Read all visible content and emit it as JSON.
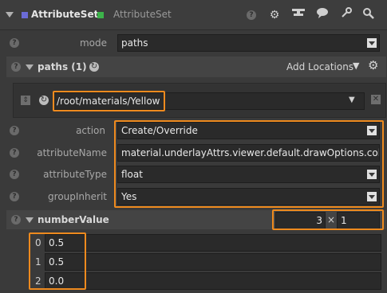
{
  "node": {
    "title": "AttributeSet",
    "subtitle": "AttributeSet",
    "icons": [
      "help-icon",
      "gear-icon",
      "network-icon",
      "chat-icon",
      "wrench-icon",
      "search-icon"
    ]
  },
  "mode": {
    "label": "mode",
    "value": "paths"
  },
  "paths": {
    "title": "paths (1)",
    "add_label": "Add Locations",
    "location": "/root/materials/Yellow"
  },
  "action": {
    "label": "action",
    "value": "Create/Override"
  },
  "attributeName": {
    "label": "attributeName",
    "value": "material.underlayAttrs.viewer.default.drawOptions.color"
  },
  "attributeType": {
    "label": "attributeType",
    "value": "float"
  },
  "groupInherit": {
    "label": "groupInherit",
    "value": "Yes"
  },
  "numberValue": {
    "title": "numberValue",
    "rows": "3",
    "times": "×",
    "cols": "1",
    "items": [
      {
        "index": "0",
        "value": "0.5"
      },
      {
        "index": "1",
        "value": "0.5"
      },
      {
        "index": "2",
        "value": "0.0"
      }
    ]
  },
  "colors": {
    "accent": "#ee8a1e",
    "node_icon": "#6b6bd6",
    "node_square": "#3cb34a"
  }
}
